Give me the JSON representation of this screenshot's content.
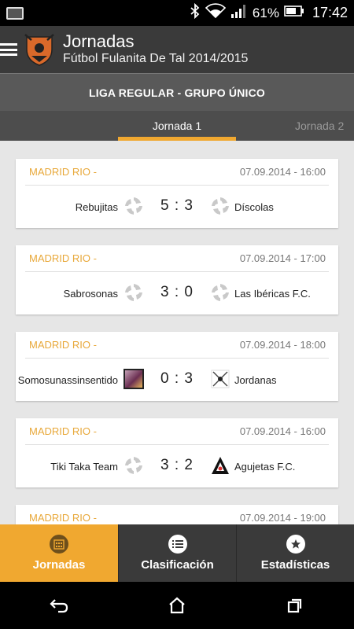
{
  "status_bar": {
    "battery_percent": "61%",
    "time": "17:42"
  },
  "app_bar": {
    "title": "Jornadas",
    "subtitle": "Fútbol Fulanita De Tal 2014/2015"
  },
  "group_header": "LIGA REGULAR - GRUPO ÚNICO",
  "tabs": [
    {
      "label": "Jornada 1"
    },
    {
      "label": "Jornada 2"
    }
  ],
  "matches": [
    {
      "venue": "MADRID RIO -",
      "datetime": "07.09.2014 - 16:00",
      "home": "Rebujitas",
      "score": "5 : 3",
      "away": "Díscolas"
    },
    {
      "venue": "MADRID RIO -",
      "datetime": "07.09.2014 - 17:00",
      "home": "Sabrosonas",
      "score": "3 : 0",
      "away": "Las Ibéricas F.C."
    },
    {
      "venue": "MADRID RIO -",
      "datetime": "07.09.2014 - 18:00",
      "home": "Somosunassinsentido",
      "score": "0 : 3",
      "away": "Jordanas"
    },
    {
      "venue": "MADRID RIO -",
      "datetime": "07.09.2014 - 16:00",
      "home": "Tiki Taka Team",
      "score": "3 : 2",
      "away": "Agujetas F.C."
    },
    {
      "venue": "MADRID RIO -",
      "datetime": "07.09.2014 - 19:00",
      "home": "",
      "score": "",
      "away": ""
    }
  ],
  "bottom_nav": [
    {
      "label": "Jornadas"
    },
    {
      "label": "Clasificación"
    },
    {
      "label": "Estadísticas"
    }
  ],
  "colors": {
    "accent": "#f0a830",
    "appbar": "#3a3a3a",
    "background": "#e6e6e6"
  }
}
